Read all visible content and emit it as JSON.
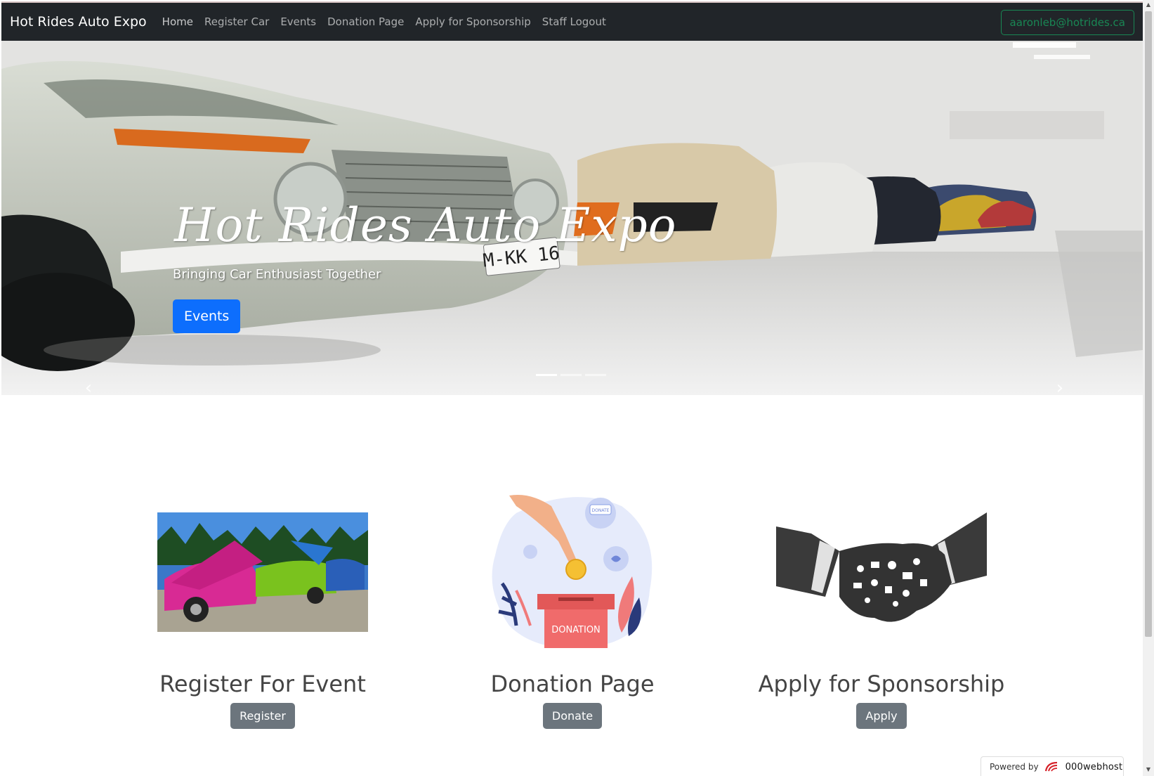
{
  "navbar": {
    "brand": "Hot Rides Auto Expo",
    "links": [
      {
        "label": "Home"
      },
      {
        "label": "Register Car"
      },
      {
        "label": "Events"
      },
      {
        "label": "Donation Page"
      },
      {
        "label": "Apply for Sponsorship"
      },
      {
        "label": "Staff Logout"
      }
    ],
    "user_email": "aaronleb@hotrides.ca"
  },
  "hero": {
    "title": "Hot Rides Auto Expo",
    "subtitle": "Bringing Car Enthusiast Together",
    "button_label": "Events",
    "slide_count": 3,
    "active_slide": 1,
    "plate_text": "M-KK 16"
  },
  "features": [
    {
      "heading": "Register For Event",
      "button_label": "Register"
    },
    {
      "heading": "Donation Page",
      "button_label": "Donate",
      "box_label": "DONATION",
      "tag_label": "DONATE"
    },
    {
      "heading": "Apply for Sponsorship",
      "button_label": "Apply"
    }
  ],
  "footer": {
    "powered_by": "Powered by",
    "host_name": "000webhost"
  },
  "colors": {
    "navbar_bg": "#212529",
    "primary": "#0d6efd",
    "secondary": "#6c757d",
    "success": "#198754"
  }
}
